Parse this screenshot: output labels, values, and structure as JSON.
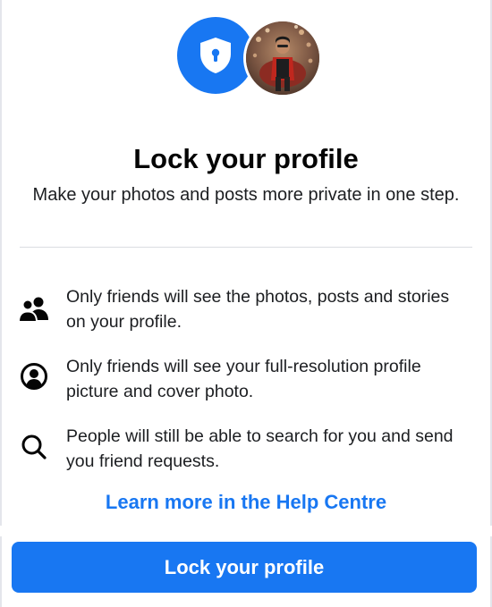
{
  "colors": {
    "brand_blue": "#1877f2",
    "text_primary": "#050505",
    "text_secondary": "#1c1e21",
    "divider": "#dadde1"
  },
  "header": {
    "shield_icon": "shield-keyhole-icon",
    "avatar": "profile-photo"
  },
  "title": "Lock your profile",
  "subtitle": "Make your photos and posts more private in one step.",
  "features": [
    {
      "icon": "friends-icon",
      "text": "Only friends will see the photos, posts and stories on your profile."
    },
    {
      "icon": "profile-circle-icon",
      "text": "Only friends will see your full-resolution profile picture and cover photo."
    },
    {
      "icon": "search-icon",
      "text": "People will still be able to search for you and send you friend requests."
    }
  ],
  "help_link": "Learn more in the Help Centre",
  "primary_button": "Lock your profile"
}
